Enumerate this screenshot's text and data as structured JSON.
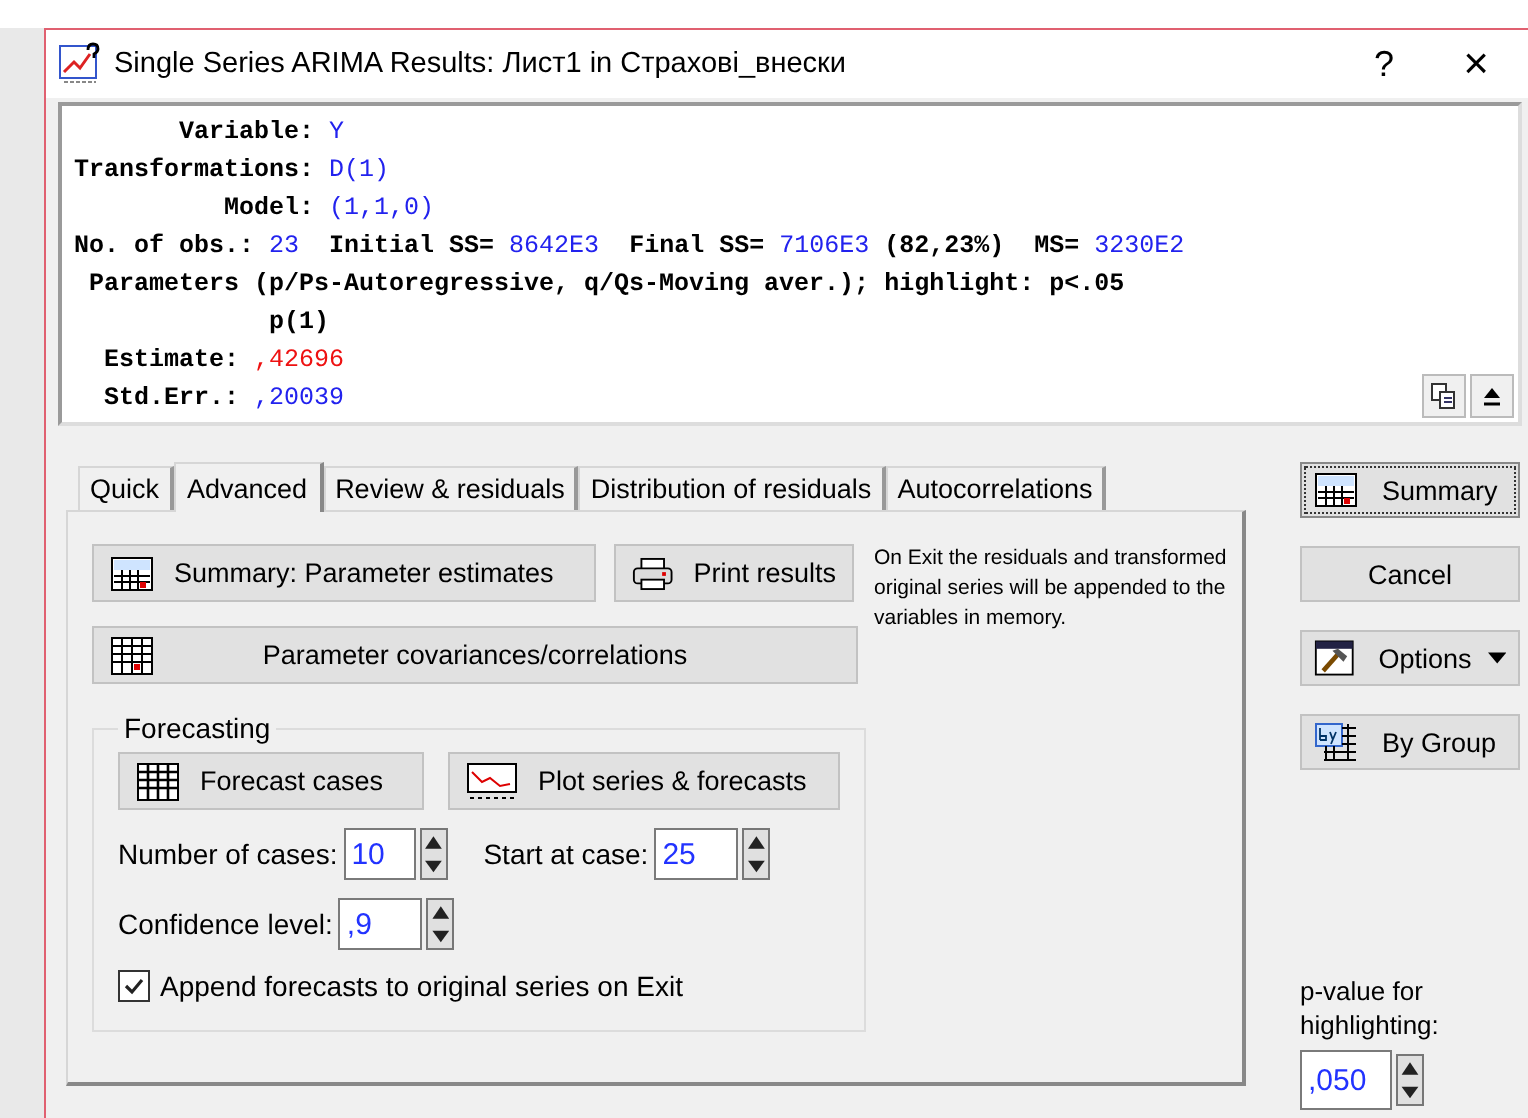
{
  "window": {
    "title": "Single Series ARIMA Results: Лист1 in Страхові_внески",
    "help": "?",
    "close": "×"
  },
  "output": {
    "lines": [
      {
        "kind": "header",
        "groups": [
          [
            {
              "text": "Variable:",
              "kind": "label"
            },
            {
              "text": "Y",
              "kind": "value"
            }
          ]
        ]
      },
      {
        "kind": "header",
        "groups": [
          [
            {
              "text": "Transformations:",
              "kind": "label"
            },
            {
              "text": "D(1)",
              "kind": "value"
            }
          ]
        ]
      },
      {
        "kind": "header",
        "groups": [
          [
            {
              "text": "Model:",
              "kind": "label"
            },
            {
              "text": "(1,1,0)",
              "kind": "value"
            }
          ]
        ]
      },
      {
        "kind": "stats",
        "groups": [
          [
            {
              "text": "No. of obs.:",
              "kind": "label"
            },
            {
              "text": "23",
              "kind": "value"
            }
          ],
          [
            {
              "text": "Initial SS=",
              "kind": "label"
            },
            {
              "text": "8642E3",
              "kind": "value"
            }
          ],
          [
            {
              "text": "Final SS=",
              "kind": "label"
            },
            {
              "text": "7106E3",
              "kind": "value"
            },
            {
              "text": "(82,23%)",
              "kind": "label"
            }
          ],
          [
            {
              "text": "MS=",
              "kind": "label"
            },
            {
              "text": "3230E2",
              "kind": "value"
            }
          ]
        ]
      },
      {
        "kind": "params",
        "groups": [
          [
            {
              "text": "Parameters (p/Ps-Autoregressive, q/Qs-Moving aver.); highlight: p<.05",
              "kind": "label"
            }
          ]
        ]
      },
      {
        "kind": "colhead",
        "groups": [
          [
            {
              "text": "p(1)",
              "kind": "label"
            }
          ]
        ]
      },
      {
        "kind": "row",
        "groups": [
          [
            {
              "text": "Estimate:",
              "kind": "label"
            },
            {
              "text": ",42696",
              "kind": "highlight"
            }
          ]
        ]
      },
      {
        "kind": "row",
        "groups": [
          [
            {
              "text": "Std.Err.:",
              "kind": "label"
            },
            {
              "text": ",20039",
              "kind": "value"
            }
          ]
        ]
      }
    ]
  },
  "tabs": [
    {
      "label": "Quick",
      "selected": false
    },
    {
      "label": "Advanced",
      "selected": true
    },
    {
      "label": "Review & residuals",
      "selected": false
    },
    {
      "label": "Distribution of residuals",
      "selected": false
    },
    {
      "label": "Autocorrelations",
      "selected": false
    }
  ],
  "advanced": {
    "summary_button": "Summary:  Parameter estimates",
    "print_button": "Print results",
    "note": "On Exit the residuals and transformed original series will be appended to the variables in memory.",
    "covariances_button": "Parameter covariances/correlations",
    "forecasting": {
      "title": "Forecasting",
      "forecast_button": "Forecast cases",
      "plot_button": "Plot series & forecasts",
      "number_of_cases": {
        "label": "Number of cases:",
        "value": "10"
      },
      "start_at_case": {
        "label": "Start at case:",
        "value": "25"
      },
      "confidence_level": {
        "label": "Confidence level:",
        "value": ",9"
      },
      "append": {
        "label": "Append forecasts to original series on Exit",
        "checked": true
      }
    }
  },
  "side": {
    "summary": "Summary",
    "cancel": "Cancel",
    "options": "Options",
    "by_group": "By Group",
    "pvalue_label": "p-value for highlighting:",
    "pvalue": ",050"
  }
}
